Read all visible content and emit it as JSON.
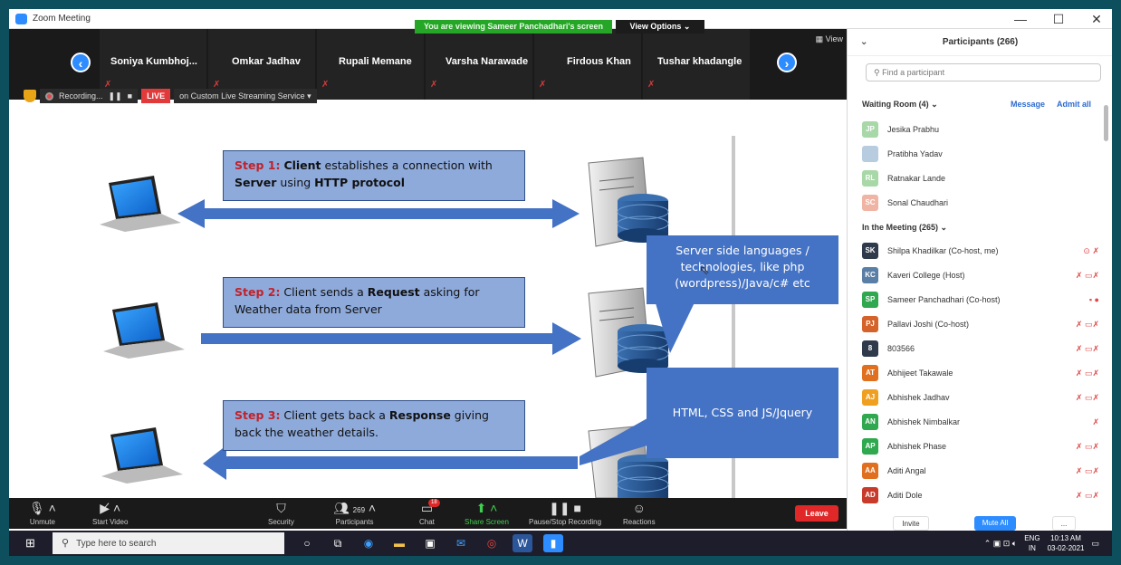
{
  "window": {
    "title": "Zoom Meeting",
    "banner": "You are viewing Sameer Panchadhari's screen",
    "view_options": "View Options ⌄",
    "controls": [
      "—",
      "☐",
      "✕"
    ]
  },
  "video_strip": {
    "view_label": "▦ View",
    "participants": [
      "Soniya  Kumbhoj...",
      "Omkar Jadhav",
      "Rupali Memane",
      "Varsha Narawade",
      "Firdous Khan",
      "Tushar khadangle"
    ]
  },
  "recording": {
    "label": "Recording...",
    "pause": "❚❚",
    "stop": "■",
    "live": "LIVE",
    "stream": "on Custom Live Streaming Service  ▾"
  },
  "slide": {
    "step1": {
      "label": "Step 1:",
      "t1": "Client",
      "t2": " establishes a connection with ",
      "t3": "Server",
      "t4": " using ",
      "t5": "HTTP protocol"
    },
    "step2": {
      "label": "Step 2:",
      "t1": " Client sends a ",
      "t2": "Request",
      "t3": " asking for Weather data from Server"
    },
    "step3": {
      "label": "Step 3:",
      "t1": " Client gets back a ",
      "t2": "Response",
      "t3": " giving back the weather details."
    },
    "callout1": "Server side languages / technologies, like php (wordpress)/Java/c# etc",
    "callout2": "HTML, CSS and JS/Jquery"
  },
  "meeting_bar": {
    "unmute": "Unmute",
    "start_video": "Start Video",
    "security": "Security",
    "participants": "Participants",
    "participants_count": "269",
    "chat": "Chat",
    "chat_badge": "18",
    "share": "Share Screen",
    "pause_rec": "Pause/Stop Recording",
    "reactions": "Reactions",
    "leave": "Leave"
  },
  "taskbar": {
    "search": "Type here to search",
    "lang": "ENG",
    "region": "IN",
    "time": "10:13 AM",
    "date": "03-02-2021"
  },
  "panel": {
    "title": "Participants (266)",
    "search_placeholder": "Find a participant",
    "waiting_label": "Waiting Room (4)  ⌄",
    "message": "Message",
    "admit_all": "Admit all",
    "waiting": [
      {
        "initials": "JP",
        "name": "Jesika Prabhu",
        "color": "#a8d8a8"
      },
      {
        "initials": "",
        "name": "Pratibha Yadav",
        "color": "#b8cce0"
      },
      {
        "initials": "RL",
        "name": "Ratnakar Lande",
        "color": "#a8d8a8"
      },
      {
        "initials": "SC",
        "name": "Sonal Chaudhari",
        "color": "#f0b4a4"
      }
    ],
    "meeting_label": "In the Meeting (265)  ⌄",
    "meeting": [
      {
        "initials": "SK",
        "name": "Shilpa Khadilkar (Co-host, me)",
        "color": "#2f3a4a",
        "icons": "⊙ ✗"
      },
      {
        "initials": "KC",
        "name": "Kaveri College (Host)",
        "color": "#5a7fa6",
        "icons": "✗ ▭✗"
      },
      {
        "initials": "SP",
        "name": "Sameer Panchadhari (Co-host)",
        "color": "#2fa84f",
        "icons": "▪ ●"
      },
      {
        "initials": "PJ",
        "name": "Pallavi Joshi (Co-host)",
        "color": "#d4622a",
        "icons": "✗ ▭✗"
      },
      {
        "initials": "8",
        "name": "803566",
        "color": "#2f3a4a",
        "icons": "✗ ▭✗"
      },
      {
        "initials": "AT",
        "name": "Abhijeet Takawale",
        "color": "#e07020",
        "icons": "✗ ▭✗"
      },
      {
        "initials": "AJ",
        "name": "Abhishek Jadhav",
        "color": "#f0a020",
        "icons": "✗ ▭✗"
      },
      {
        "initials": "AN",
        "name": "Abhishek Nimbalkar",
        "color": "#2fa84f",
        "icons": "✗"
      },
      {
        "initials": "AP",
        "name": "Abhishek Phase",
        "color": "#2fa84f",
        "icons": "✗ ▭✗"
      },
      {
        "initials": "AA",
        "name": "Aditi Angal",
        "color": "#e07020",
        "icons": "✗ ▭✗"
      },
      {
        "initials": "AD",
        "name": "Aditi Dole",
        "color": "#c83a2a",
        "icons": "✗ ▭✗"
      }
    ],
    "invite": "Invite",
    "mute_all": "Mute All",
    "more": "..."
  }
}
